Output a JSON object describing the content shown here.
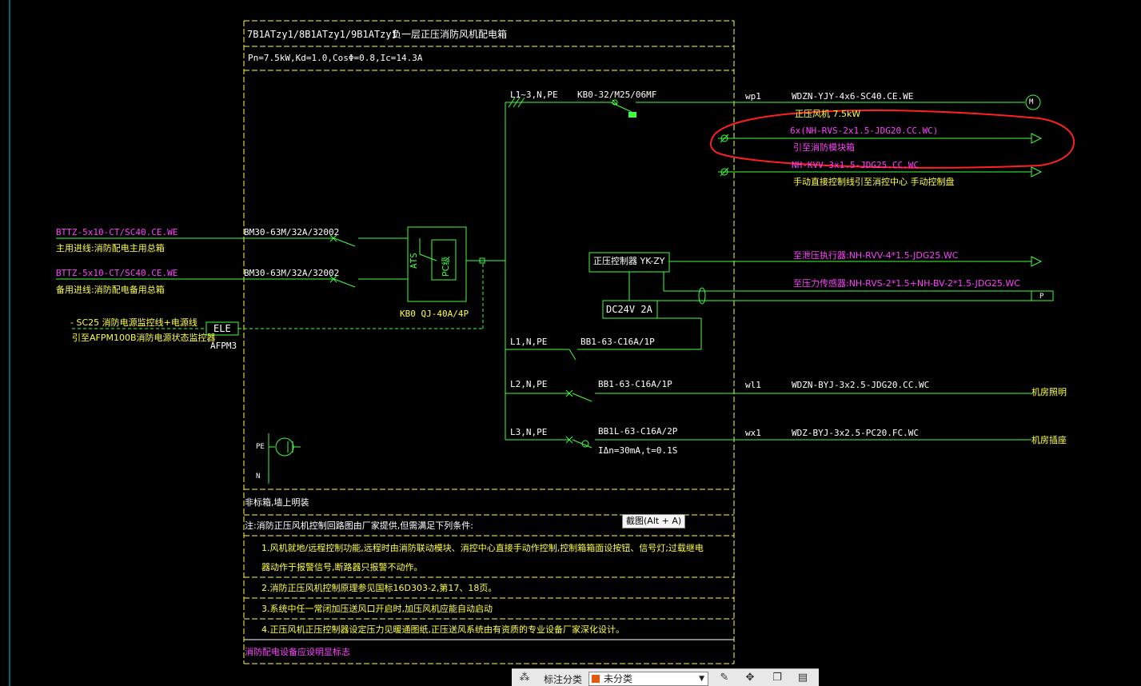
{
  "panel": {
    "title_codes": "7B1ATzy1/8B1ATzy1/9B1ATzy1",
    "title_name": "负一层正压消防风机配电箱",
    "params": "Pn=7.5kW,Kd=1.0,CosΦ=0.8,Ic=14.3A"
  },
  "incoming": {
    "main_cable": "BTTZ-5x10-CT/SC40.CE.WE",
    "main_desc": "主用进线:消防配电主用总箱",
    "main_breaker": "BM30-63M/32A/32002",
    "backup_cable": "BTTZ-5x10-CT/SC40.CE.WE",
    "backup_desc": "备用进线:消防配电备用总箱",
    "backup_breaker": "BM30-63M/32A/32002",
    "monitor_line1": "- SC25 消防电源监控线+电源线",
    "monitor_line2": "引至AFPM100B消防电源状态监控器",
    "ele_label": "ELE",
    "afpm_label": "AFPM3",
    "ats_label": "ATS",
    "pc_label": "PC级",
    "ats_model": "KB0 QJ-40A/4P"
  },
  "circuits": {
    "main_bus": "L1~3,N,PE",
    "main_breaker": "KB0-32/M25/06MF",
    "wp1_id": "wp1",
    "wp1_cable": "WDZN-YJY-4x6-SC40.CE.WE",
    "wp1_load": "正压风机  7.5kW",
    "motor_symbol": "M",
    "ctrl1_cable": "6x(NH-RVS-2x1.5-JDG20.CC.WC)",
    "ctrl1_desc": "引至消防模块箱",
    "ctrl2_cable": "NH-KVV-3x1.5-JDG25.CC.WC",
    "ctrl2_desc": "手动直接控制线引至消控中心 手动控制盘",
    "controller_label": "正压控制器 YK-ZY",
    "controller_out1": "至泄压执行器:NH-RVV-4*1.5-JDG25.WC",
    "controller_out2": "至压力传感器:NH-RVS-2*1.5+NH-BV-2*1.5-JDG25.WC",
    "p_label": "P",
    "dc_label": "DC24V  2A",
    "c1_bus": "L1,N,PE",
    "c1_breaker": "BB1-63-C16A/1P",
    "c2_bus": "L2,N,PE",
    "c2_breaker": "BB1-63-C16A/1P",
    "wl1_id": "wl1",
    "wl1_cable": "WDZN-BYJ-3x2.5-JDG20.CC.WC",
    "wl1_load": "机房照明",
    "c3_bus": "L3,N,PE",
    "c3_breaker": "BB1L-63-C16A/2P",
    "c3_rcd": "IΔn=30mA,t=0.1S",
    "wx1_id": "wx1",
    "wx1_cable": "WDZ-BYJ-3x2.5-PC20.FC.WC",
    "wx1_load": "机房插座",
    "pe_label": "PE",
    "n_label": "N"
  },
  "notes": {
    "header": "非标箱,墙上明装",
    "note_intro": "注:消防正压风机控制回路图由厂家提供,但需满足下列条件:",
    "item1a": "1.风机就地/远程控制功能,远程时由消防联动模块、消控中心直接手动作控制,控制箱箱面设按钮、信号灯;过载继电",
    "item1b": "器动作于报警信号,断路器只报警不动作。",
    "item2": "2.消防正压风机控制原理参见国标16D303-2,第17、18页。",
    "item3": "3.系统中任一常闭加压送风口开启时,加压风机应能自动启动",
    "item4": "4.正压风机正压控制器设定压力见暖通图纸,正压送风系统由有资质的专业设备厂家深化设计。",
    "footer": "消防配电设备应设明显标志"
  },
  "ui": {
    "tooltip": "截图(Alt + A)",
    "category_label": "标注分类",
    "category_value": "未分类",
    "category_color": "#e05a10"
  },
  "colors": {
    "background": "#000000",
    "line_green": "#40ff40",
    "text_white": "#ffffff",
    "text_yellow": "#ffff40",
    "text_magenta": "#ff40ff",
    "frame_yellow": "#ffff40",
    "markup_red": "#ff2020"
  }
}
